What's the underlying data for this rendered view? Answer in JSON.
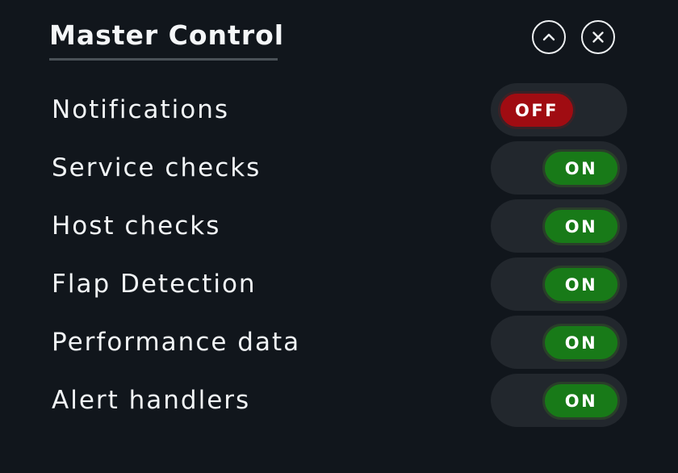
{
  "header": {
    "title": "Master Control",
    "collapse_icon": "chevron-up-icon",
    "close_icon": "close-icon"
  },
  "colors": {
    "background": "#11161c",
    "toggle_track": "#22272d",
    "on": "#187a18",
    "off": "#a00c12",
    "text": "#f1f4f6"
  },
  "switches": [
    {
      "label": "Notifications",
      "state": "OFF"
    },
    {
      "label": "Service checks",
      "state": "ON"
    },
    {
      "label": "Host checks",
      "state": "ON"
    },
    {
      "label": "Flap Detection",
      "state": "ON"
    },
    {
      "label": "Performance data",
      "state": "ON"
    },
    {
      "label": "Alert handlers",
      "state": "ON"
    }
  ]
}
